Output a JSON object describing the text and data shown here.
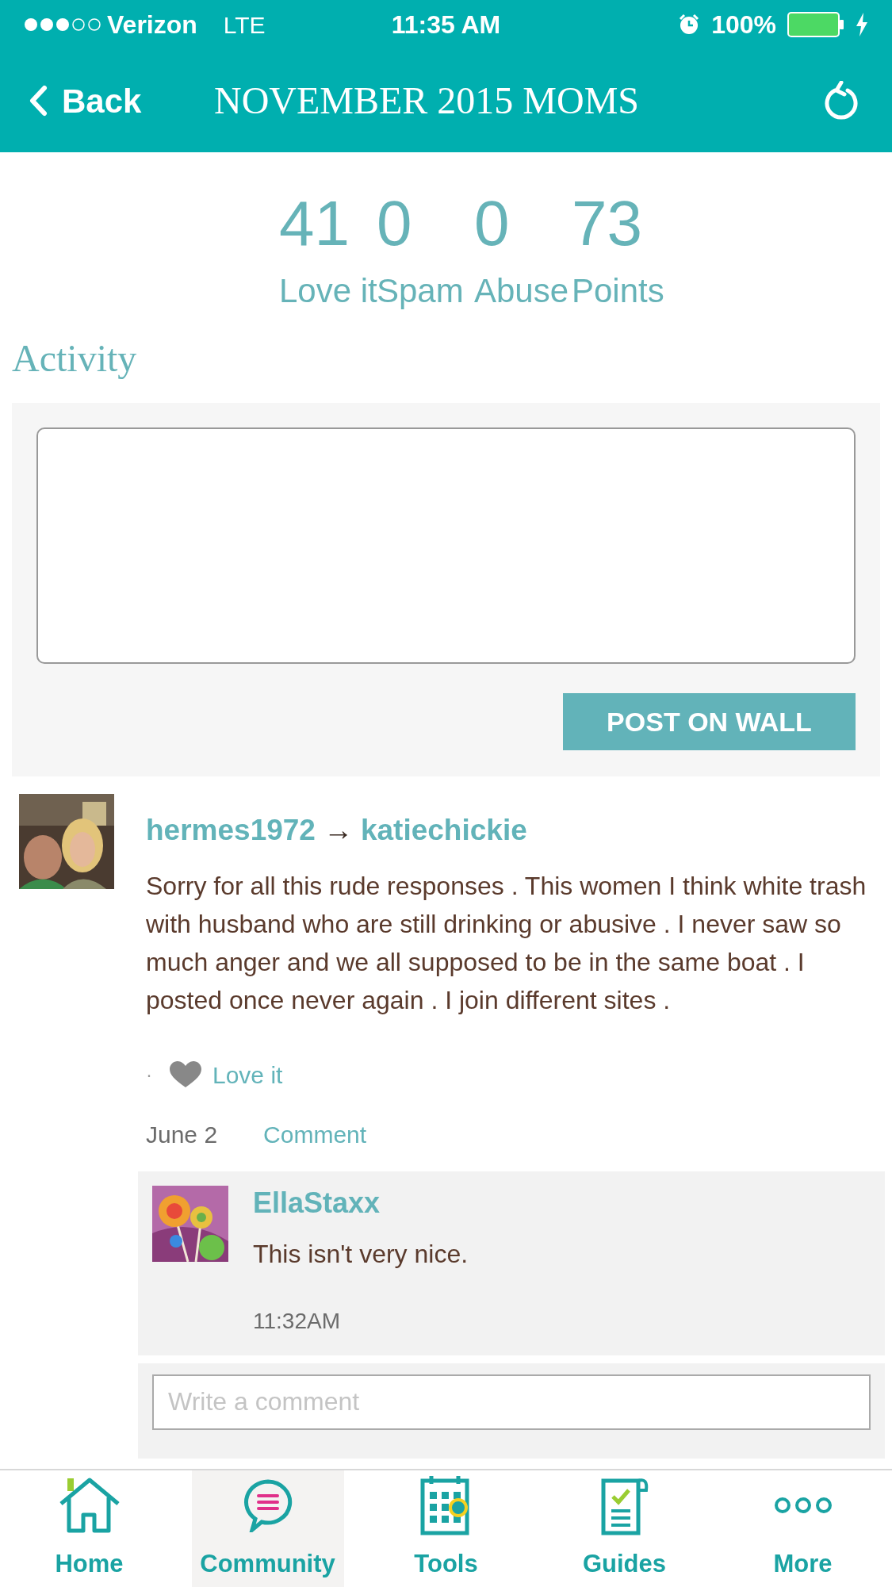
{
  "status_bar": {
    "carrier": "Verizon",
    "network": "LTE",
    "time": "11:35 AM",
    "battery": "100%"
  },
  "nav_bar": {
    "back": "Back",
    "title": "NOVEMBER 2015 MOMS"
  },
  "stats": [
    {
      "value": "41",
      "label": "Love it"
    },
    {
      "value": "0",
      "label": "Spam"
    },
    {
      "value": "0",
      "label": "Abuse"
    },
    {
      "value": "73",
      "label": "Points"
    }
  ],
  "activity": {
    "heading": "Activity",
    "post_button": "POST ON WALL"
  },
  "posts": [
    {
      "author": "hermes1972",
      "arrow": "→",
      "recipient": "katiechickie",
      "body": "Sorry for all this rude responses . This women I think white trash with husband who are still drinking or abusive . I never saw so much anger and we all supposed to be in the same boat . I posted once never again . I join different sites .",
      "love_dot": "·",
      "love_label": "Love it",
      "date": "June 2",
      "comment_link": "Comment",
      "comments": [
        {
          "author": "EllaStaxx",
          "text": "This isn't very nice.",
          "time": "11:32AM"
        }
      ],
      "comment_placeholder": "Write a comment"
    }
  ],
  "tabs": [
    {
      "kind": "home",
      "label": "Home",
      "selected": false
    },
    {
      "kind": "community",
      "label": "Community",
      "selected": true
    },
    {
      "kind": "tools",
      "label": "Tools",
      "selected": false
    },
    {
      "kind": "guides",
      "label": "Guides",
      "selected": false
    },
    {
      "kind": "more",
      "label": "More",
      "selected": false
    }
  ]
}
